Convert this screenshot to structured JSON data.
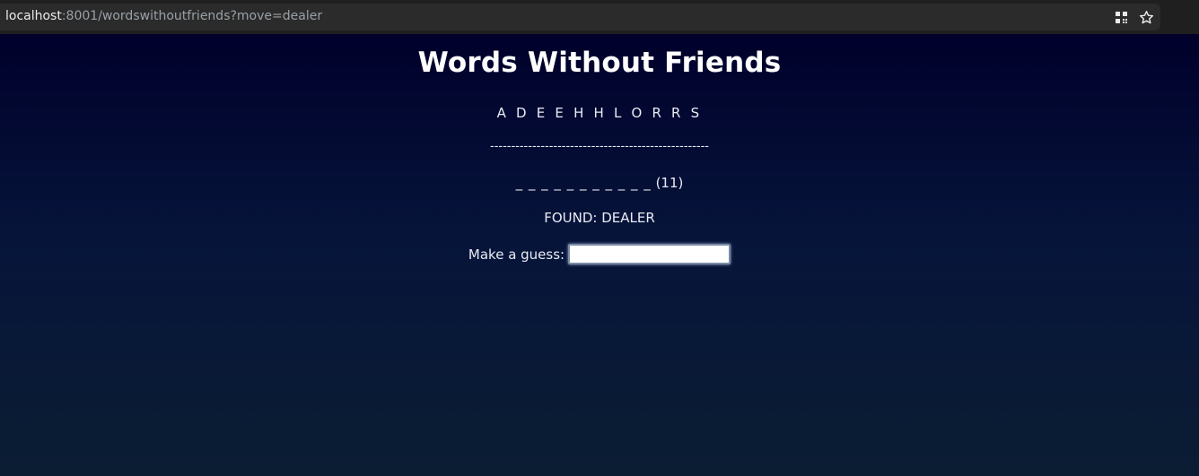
{
  "browser": {
    "url_host": "localhost",
    "url_rest": ":8001/wordswithoutfriends?move=dealer",
    "icons": [
      "qr-code-icon",
      "star-icon"
    ]
  },
  "game": {
    "title": "Words Without Friends",
    "letters": "A D E E H H L O R R S",
    "divider": "----------------------------------------------------",
    "blanks": "_ _ _ _ _ _ _ _ _ _ _",
    "blank_count": "(11)",
    "found": "FOUND: DEALER",
    "guess_label": "Make a guess:",
    "guess_value": ""
  }
}
